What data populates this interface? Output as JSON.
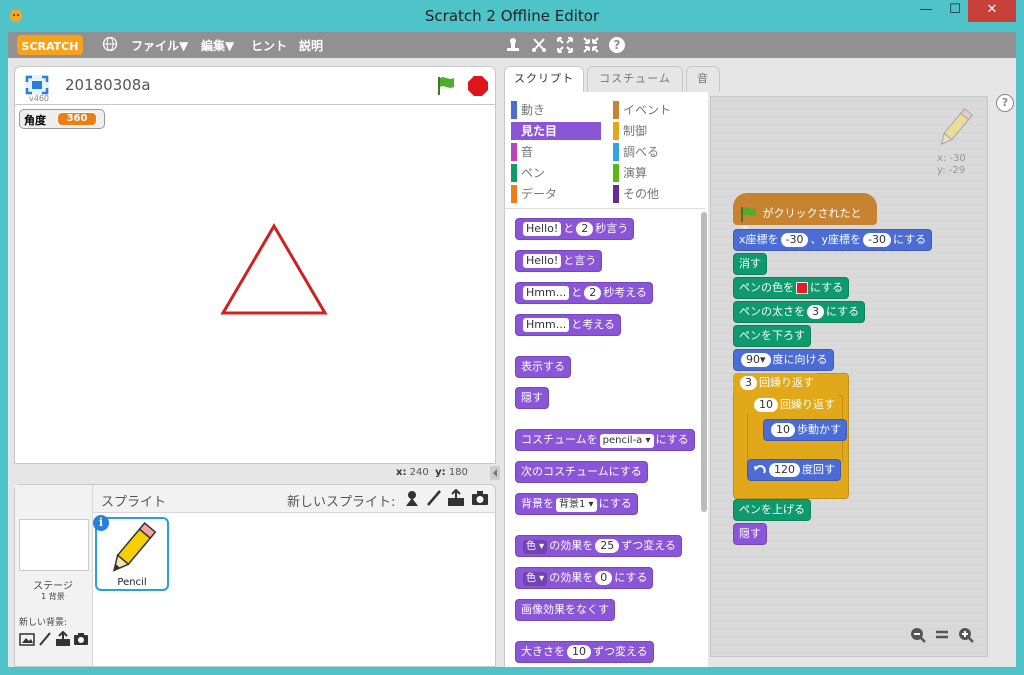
{
  "window": {
    "title": "Scratch 2 Offline Editor",
    "min": "—",
    "max": "☐",
    "close": "✕"
  },
  "menu": {
    "file": "ファイル▼",
    "edit": "編集▼",
    "hints": "ヒント",
    "about": "説明",
    "logo": "SCRATCH"
  },
  "stage": {
    "project_name": "20180308a",
    "version": "v460",
    "variable_name": "角度",
    "variable_value": "360",
    "x_label": "x:",
    "x_value": "240",
    "y_label": "y:",
    "y_value": "180"
  },
  "sprites": {
    "label": "スプライト",
    "new_sprite": "新しいスプライト:",
    "stage_label": "ステージ",
    "stage_bg_count": "1 背景",
    "new_backdrop": "新しい背景:",
    "sprite_name": "Pencil",
    "info": "i"
  },
  "tabs": {
    "scripts": "スクリプト",
    "costumes": "コスチューム",
    "sounds": "音"
  },
  "categories": {
    "motion": "動き",
    "looks": "見た目",
    "sound": "音",
    "pen": "ペン",
    "data": "データ",
    "events": "イベント",
    "control": "制御",
    "sensing": "調べる",
    "operators": "演算",
    "more": "その他"
  },
  "palette": {
    "say_for": {
      "msg": "Hello!",
      "mid": "と",
      "secs": "2",
      "end": "秒言う"
    },
    "say": {
      "msg": "Hello!",
      "end": "と言う"
    },
    "think_for": {
      "msg": "Hmm...",
      "mid": "と",
      "secs": "2",
      "end": "秒考える"
    },
    "think": {
      "msg": "Hmm...",
      "end": "と考える"
    },
    "show": "表示する",
    "hide": "隠す",
    "switch_costume": {
      "a": "コスチュームを",
      "val": "pencil-a",
      "b": "にする"
    },
    "next_costume": "次のコスチュームにする",
    "switch_backdrop": {
      "a": "背景を",
      "val": "背景1",
      "b": "にする"
    },
    "change_effect": {
      "val": "色",
      "a": "の効果を",
      "num": "25",
      "b": "ずつ変える"
    },
    "set_effect": {
      "val": "色",
      "a": "の効果を",
      "num": "0",
      "b": "にする"
    },
    "clear_effects": "画像効果をなくす",
    "change_size": {
      "a": "大きさを",
      "num": "10",
      "b": "ずつ変える"
    }
  },
  "script": {
    "hat": "がクリックされたとき",
    "goto": {
      "a": "x座標を",
      "x": "-30",
      "b": "、y座標を",
      "y": "-30",
      "c": "にする"
    },
    "clear": "消す",
    "pen_color": {
      "a": "ペンの色を",
      "b": "にする",
      "color": "#e02020"
    },
    "pen_size": {
      "a": "ペンの太さを",
      "num": "3",
      "b": "にする"
    },
    "pen_down": "ペンを下ろす",
    "point": {
      "num": "90▾",
      "b": "度に向ける"
    },
    "repeat_outer": {
      "num": "3",
      "b": "回繰り返す"
    },
    "repeat_inner": {
      "num": "10",
      "b": "回繰り返す"
    },
    "move": {
      "num": "10",
      "b": "歩動かす"
    },
    "turn": {
      "num": "120",
      "b": "度回す"
    },
    "pen_up": "ペンを上げる",
    "hide": "隠す",
    "sprite_x": "x: -30",
    "sprite_y": "y: -29"
  },
  "colors": {
    "looks": "#8a55d7",
    "motion": "#4a6cd4",
    "pen": "#0e9a6c",
    "events": "#c88330",
    "control": "#e1a91a"
  }
}
